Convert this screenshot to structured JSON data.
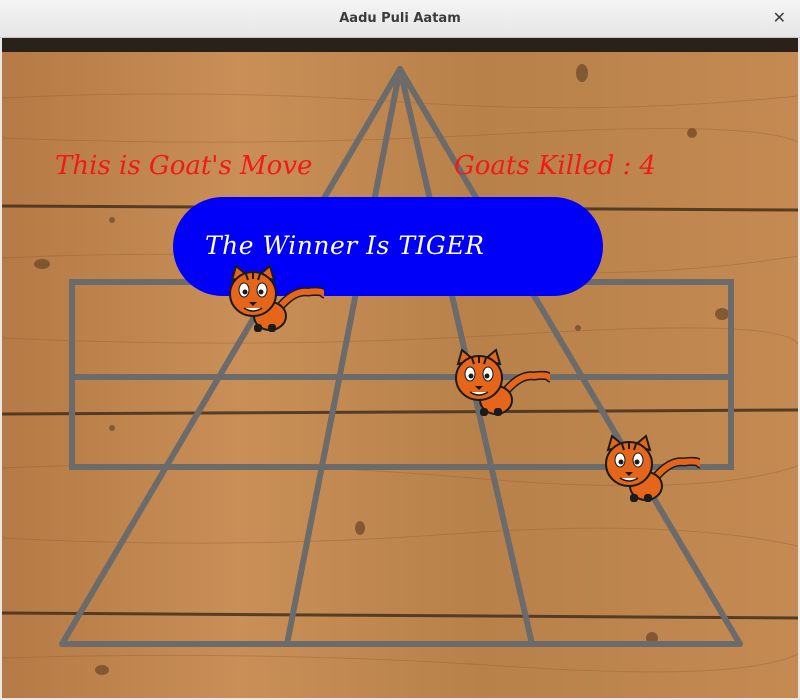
{
  "window": {
    "title": "Aadu Puli Aatam",
    "close_glyph": "✕"
  },
  "status": {
    "move_text": "This is Goat's Move",
    "killed_label": "Goats Killed :",
    "killed_count": "4"
  },
  "banner": {
    "text": "The Winner Is TIGER"
  },
  "pieces": [
    {
      "type": "tiger",
      "icon": "tiger-icon",
      "position": "top-left node of middle bar"
    },
    {
      "type": "tiger",
      "icon": "tiger-icon",
      "position": "center right node"
    },
    {
      "type": "tiger",
      "icon": "tiger-icon",
      "position": "right node of lower bar"
    }
  ],
  "colors": {
    "board_lines": "#6b6b6b",
    "status_text": "#f01a1a",
    "banner": "#0000f8",
    "banner_text": "#ffffff",
    "tiger_body": "#e5661b"
  }
}
